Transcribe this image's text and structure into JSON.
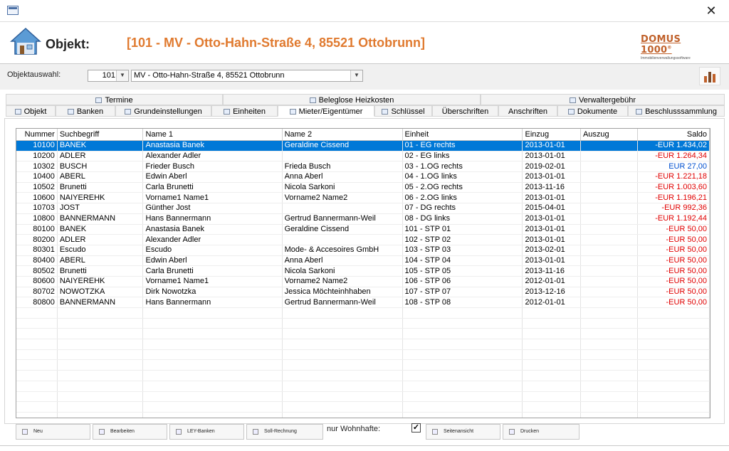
{
  "window": {
    "close_glyph": "✕"
  },
  "header": {
    "object_label": "Objekt:",
    "object_title": "[101 - MV - Otto-Hahn-Straße 4, 85521 Ottobrunn]",
    "logo_text": "DOMUS 1000",
    "logo_mark": "®",
    "logo_sub": "Immobilienverwaltungssoftware",
    "accent_color": "#e07a2f"
  },
  "selector": {
    "label": "Objektauswahl:",
    "number": "101",
    "address": "MV - Otto-Hahn-Straße 4, 85521 Ottobrunn"
  },
  "tabs_top": [
    {
      "label": "Termine",
      "icon": "calendar-icon"
    },
    {
      "label": "Beleglose Heizkosten",
      "icon": "heat-icon"
    },
    {
      "label": "Verwaltergebühr",
      "icon": "fee-icon"
    }
  ],
  "tabs_bottom": [
    {
      "label": "Objekt",
      "icon": "object-icon"
    },
    {
      "label": "Banken",
      "icon": "bank-icon"
    },
    {
      "label": "Grundeinstellungen",
      "icon": "settings-icon"
    },
    {
      "label": "Einheiten",
      "icon": "units-icon"
    },
    {
      "label": "Mieter/Eigentümer",
      "icon": "people-icon",
      "active": true
    },
    {
      "label": "Schlüssel",
      "icon": "key-icon"
    },
    {
      "label": "Überschriften",
      "icon": ""
    },
    {
      "label": "Anschriften",
      "icon": ""
    },
    {
      "label": "Dokumente",
      "icon": "document-icon"
    },
    {
      "label": "Beschlusssammlung",
      "icon": "resolution-icon"
    }
  ],
  "table": {
    "columns": [
      "Nummer",
      "Suchbegriff",
      "Name 1",
      "Name 2",
      "Einheit",
      "Einzug",
      "Auszug",
      "Saldo"
    ],
    "rows": [
      [
        "10100",
        "BANEK",
        "Anastasia Banek",
        "Geraldine Cissend",
        "01 - EG rechts",
        "2013-01-01",
        "",
        "-EUR 1.434,02"
      ],
      [
        "10200",
        "ADLER",
        "Alexander Adler",
        "",
        "02 - EG links",
        "2013-01-01",
        "",
        "-EUR 1.264,34"
      ],
      [
        "10302",
        "BUSCH",
        "Frieder Busch",
        "Frieda Busch",
        "03 - 1.OG rechts",
        "2019-02-01",
        "",
        "EUR 27,00"
      ],
      [
        "10400",
        "ABERL",
        "Edwin Aberl",
        "Anna Aberl",
        "04 - 1.OG links",
        "2013-01-01",
        "",
        "-EUR 1.221,18"
      ],
      [
        "10502",
        "Brunetti",
        "Carla Brunetti",
        "Nicola Sarkoni",
        "05 - 2.OG rechts",
        "2013-11-16",
        "",
        "-EUR 1.003,60"
      ],
      [
        "10600",
        "NAIYEREHK",
        "Vorname1 Name1",
        "Vorname2 Name2",
        "06 - 2.OG links",
        "2013-01-01",
        "",
        "-EUR 1.196,21"
      ],
      [
        "10703",
        "JOST",
        "Günther Jost",
        "",
        "07 - DG rechts",
        "2015-04-01",
        "",
        "-EUR 992,36"
      ],
      [
        "10800",
        "BANNERMANN",
        "Hans Bannermann",
        "Gertrud Bannermann-Weil",
        "08 - DG links",
        "2013-01-01",
        "",
        "-EUR 1.192,44"
      ],
      [
        "80100",
        "BANEK",
        "Anastasia Banek",
        "Geraldine Cissend",
        "101 - STP 01",
        "2013-01-01",
        "",
        "-EUR 50,00"
      ],
      [
        "80200",
        "ADLER",
        "Alexander Adler",
        "",
        "102 - STP 02",
        "2013-01-01",
        "",
        "-EUR 50,00"
      ],
      [
        "80301",
        "Escudo",
        "Escudo",
        "Mode- & Accesoires GmbH",
        "103 - STP 03",
        "2013-02-01",
        "",
        "-EUR 50,00"
      ],
      [
        "80400",
        "ABERL",
        "Edwin Aberl",
        "Anna Aberl",
        "104 - STP 04",
        "2013-01-01",
        "",
        "-EUR 50,00"
      ],
      [
        "80502",
        "Brunetti",
        "Carla Brunetti",
        "Nicola Sarkoni",
        "105 - STP 05",
        "2013-11-16",
        "",
        "-EUR 50,00"
      ],
      [
        "80600",
        "NAIYEREHK",
        "Vorname1 Name1",
        "Vorname2 Name2",
        "106 - STP 06",
        "2012-01-01",
        "",
        "-EUR 50,00"
      ],
      [
        "80702",
        "NOWOTZKA",
        "Dirk Nowotzka",
        "Jessica Möchteinhhaben",
        "107 - STP 07",
        "2013-12-16",
        "",
        "-EUR 50,00"
      ],
      [
        "80800",
        "BANNERMANN",
        "Hans Bannermann",
        "Gertrud Bannermann-Weil",
        "108 - STP 08",
        "2012-01-01",
        "",
        "-EUR 50,00"
      ]
    ],
    "selected_row": 0,
    "negative_color": "#e00000",
    "positive_color": "#0050d0",
    "selection_color": "#0078d7"
  },
  "footer": {
    "buttons": [
      "Neu",
      "Bearbeiten",
      "LEY-Banken",
      "Soll-Rechnung"
    ],
    "buttons_right": [
      "Seitenansicht",
      "Drucken"
    ],
    "only_residents_label": "nur Wohnhafte:",
    "only_residents_checked": "✓"
  }
}
